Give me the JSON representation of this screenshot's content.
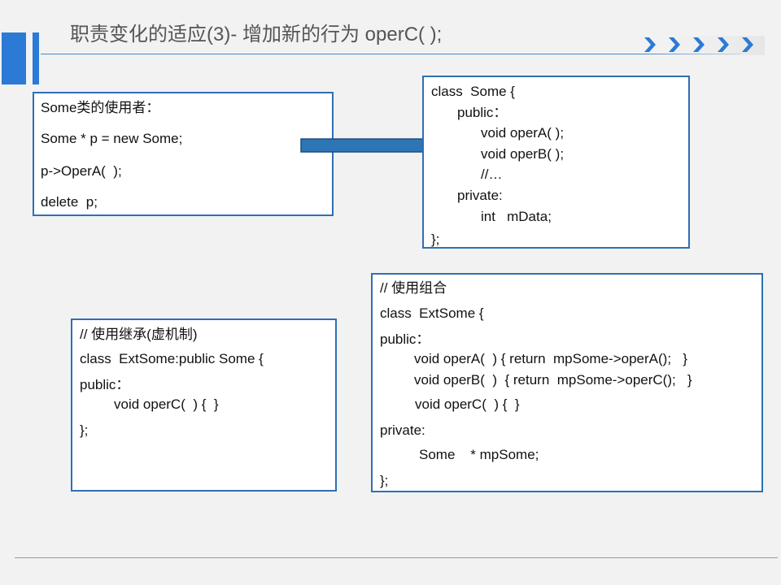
{
  "slide": {
    "title": "职责变化的适应(3)- 增加新的行为 operC( );"
  },
  "user_box": {
    "lines": [
      "Some类的使用者：",
      "Some * p = new Some;",
      "p->OperA(  );",
      "delete  p;"
    ]
  },
  "some_class_box": {
    "lines": [
      "class  Some {",
      "public：",
      "void operA( );",
      "void operB( );",
      "//…",
      "private:",
      "int   mData;",
      "};"
    ]
  },
  "inherit_box": {
    "lines": [
      "// 使用继承(虚机制)",
      "class  ExtSome:public Some {",
      "public：",
      "void operC(  ) {  }",
      "};"
    ]
  },
  "compose_box": {
    "lines": [
      "// 使用组合",
      "class  ExtSome {",
      "public：",
      "void operA(  ) { return  mpSome->operA();   }",
      "void operB(  )  { return  mpSome->operC();   }",
      "void operC(  ) {  }",
      "private:",
      "Some    * mpSome;",
      "};"
    ]
  },
  "icons": {
    "chevrons": "chevron-right-icon",
    "arrow": "arrow-right-icon"
  },
  "colors": {
    "accent": "#2b7ad6",
    "border": "#2f6fb6",
    "arrow_fill": "#2e75b6"
  }
}
